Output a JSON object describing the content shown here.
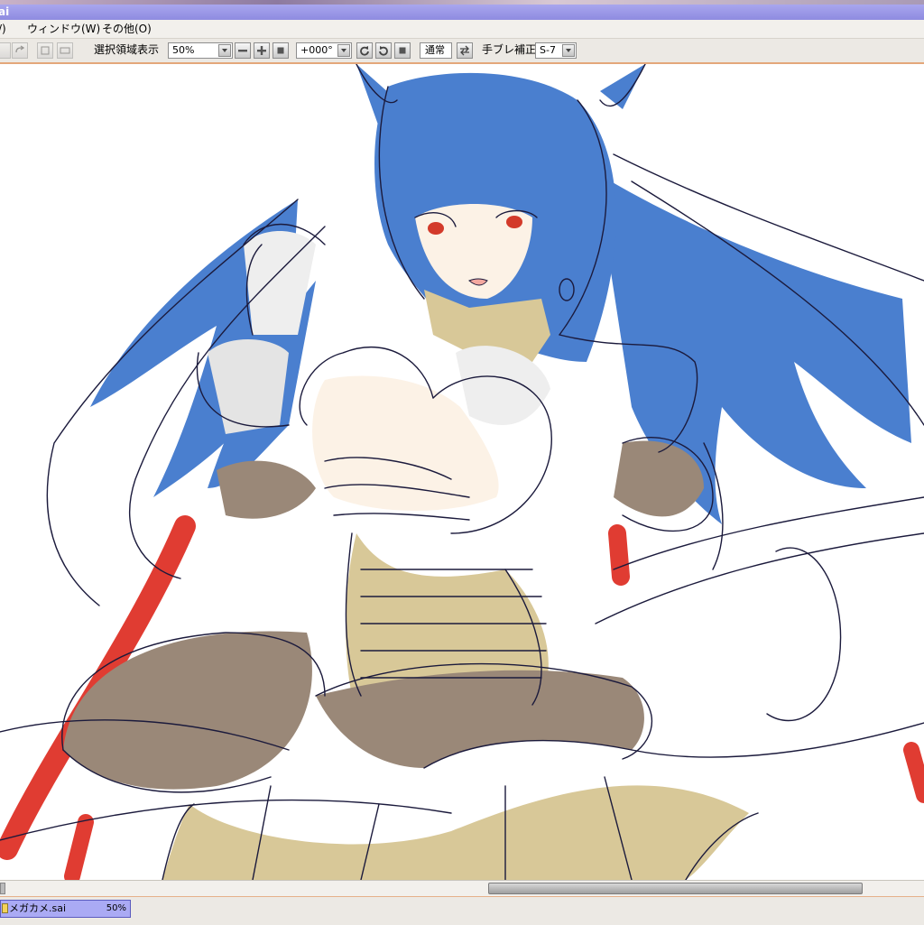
{
  "window": {
    "title": "ai"
  },
  "menu": [
    {
      "id": "menu-edge",
      "label": "/)"
    },
    {
      "id": "menu-window",
      "label": "ウィンドウ(W)"
    },
    {
      "id": "menu-other",
      "label": "その他(O)"
    }
  ],
  "toolbar": {
    "show_selection_label": "選択領域表示",
    "show_selection_checked": true,
    "zoom_value": "50%",
    "rotation_value": "+000°",
    "blend_mode_label": "通常",
    "stabilizer_label": "手ブレ補正",
    "stabilizer_value": "S-7"
  },
  "document_tab": {
    "name": "メガカメ.sai",
    "zoom": "50%"
  },
  "colors": {
    "hair": "#4a7fcf",
    "outline": "#1b1a3c",
    "gold": "#d8c898",
    "brown": "#9a8878",
    "red": "#e03c32",
    "skin": "#fcf2e6",
    "titlebar": "#9c99e8",
    "tab": "#aaaaf4"
  },
  "canvas": {
    "content": "anime-girl-sketch"
  }
}
